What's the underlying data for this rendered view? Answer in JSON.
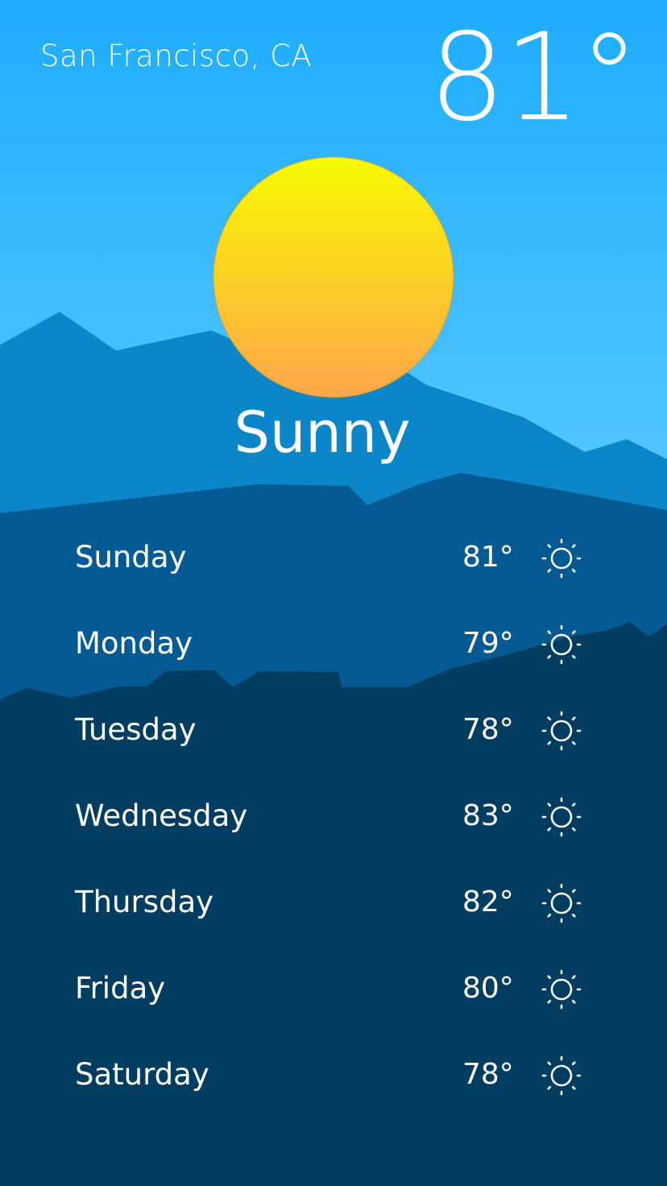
{
  "header": {
    "location": "San Francisco, CA",
    "current_temp": "81°"
  },
  "hero": {
    "icon": "sun-icon",
    "condition": "Sunny"
  },
  "forecast": [
    {
      "day": "Sunday",
      "temp": "81°",
      "icon": "sun-outline-icon"
    },
    {
      "day": "Monday",
      "temp": "79°",
      "icon": "sun-outline-icon"
    },
    {
      "day": "Tuesday",
      "temp": "78°",
      "icon": "sun-outline-icon"
    },
    {
      "day": "Wednesday",
      "temp": "83°",
      "icon": "sun-outline-icon"
    },
    {
      "day": "Thursday",
      "temp": "82°",
      "icon": "sun-outline-icon"
    },
    {
      "day": "Friday",
      "temp": "80°",
      "icon": "sun-outline-icon"
    },
    {
      "day": "Saturday",
      "temp": "78°",
      "icon": "sun-outline-icon"
    }
  ],
  "colors": {
    "sky_top": "#1eadfe",
    "sky_bottom": "#74cfff",
    "mountain_far": "#0a86c9",
    "mountain_mid": "#055a93",
    "mountain_near": "#003d61",
    "sun_top": "#f7fb00",
    "sun_bottom": "#ffa64b",
    "text": "#ffffff"
  }
}
